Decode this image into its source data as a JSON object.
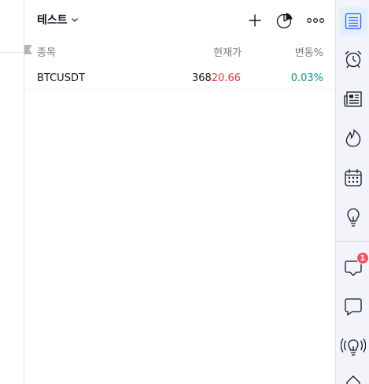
{
  "watchlist": {
    "title": "테스트",
    "columns": {
      "symbol": "종목",
      "last": "현재가",
      "change": "변동%"
    },
    "rows": [
      {
        "symbol": "BTCUSDT",
        "last_prefix": "368",
        "last_suffix": "20.66",
        "change": "0.03%"
      }
    ]
  },
  "header_icons": [
    "chevron-down-icon",
    "plus-icon",
    "pie-chart-icon",
    "more-icon"
  ],
  "rightbar": {
    "items": [
      "watchlist-icon",
      "alarm-clock-icon",
      "news-icon",
      "fire-icon",
      "calendar-icon",
      "lightbulb-icon",
      "chat-icon",
      "chat-bubble-icon",
      "streams-icon",
      "more-shape-icon"
    ],
    "notification_count": "1"
  },
  "colors": {
    "negative": "#f23645",
    "positive": "#089981",
    "accent": "#2962ff",
    "badge": "#f7525f"
  }
}
